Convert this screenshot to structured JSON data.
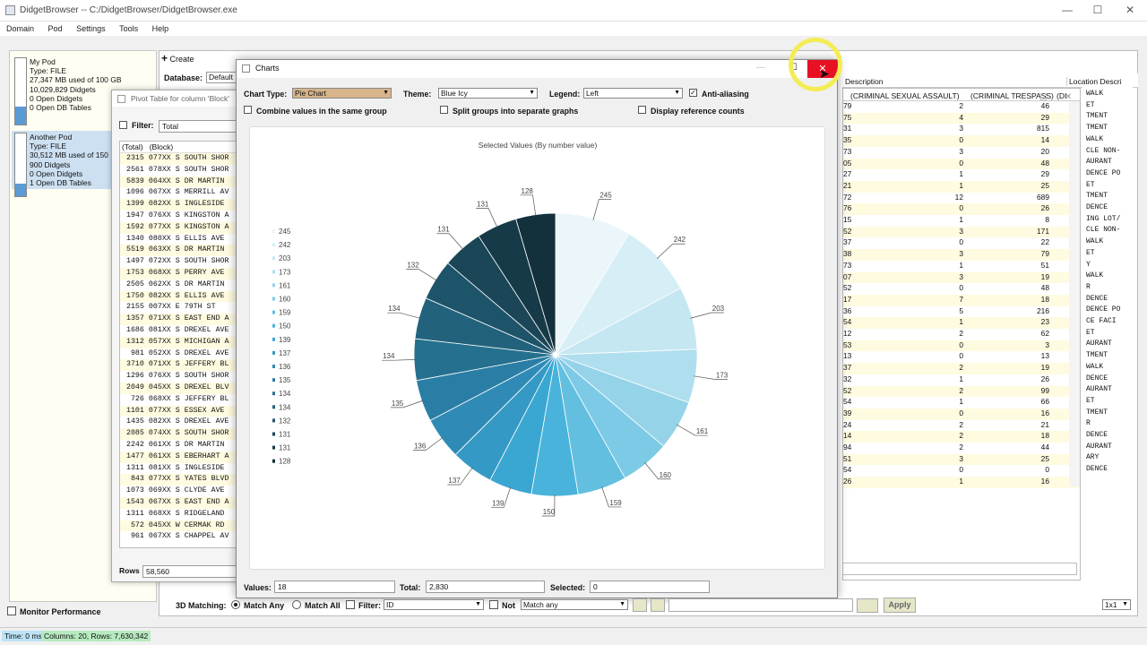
{
  "app": {
    "title": "DidgetBrowser  --  C:/DidgetBrowser/DidgetBrowser.exe"
  },
  "menu": [
    "Domain",
    "Pod",
    "Settings",
    "Tools",
    "Help"
  ],
  "pods": [
    {
      "name": "My Pod",
      "type": "Type: FILE",
      "usage": "27,347 MB used of 100 GB",
      "didgets": "10,029,829 Didgets",
      "open_didgets": "0 Open Didgets",
      "open_tables": "0 Open DB Tables",
      "fill": 0.27
    },
    {
      "name": "Another Pod",
      "type": "Type: FILE",
      "usage": "30,512 MB used of 150",
      "didgets": "900 Didgets",
      "open_didgets": "0 Open Didgets",
      "open_tables": "1 Open DB Tables",
      "fill": 0.2
    }
  ],
  "monitor_performance": "Monitor Performance",
  "toolbar": {
    "create": "Create",
    "database_label": "Database:",
    "database_value": "Default"
  },
  "grid": {
    "headers": [
      "(CRIMINAL SEXUAL ASSAULT)",
      "(CRIMINAL TRESPASS)",
      "(DI",
      "Description",
      "Location Descri"
    ],
    "rows": [
      [
        "2",
        "46",
        "WALK"
      ],
      [
        "4",
        "29",
        "ET"
      ],
      [
        "3",
        "815",
        "TMENT"
      ],
      [
        "0",
        "14",
        "TMENT"
      ],
      [
        "3",
        "20",
        "WALK"
      ],
      [
        "0",
        "48",
        "CLE NON-"
      ],
      [
        "1",
        "29",
        "AURANT"
      ],
      [
        "1",
        "25",
        "DENCE PO"
      ],
      [
        "12",
        "689",
        "ET"
      ],
      [
        "0",
        "26",
        "TMENT"
      ],
      [
        "1",
        "8",
        "DENCE"
      ],
      [
        "3",
        "171",
        "ING LOT/"
      ],
      [
        "0",
        "22",
        "CLE NON-"
      ],
      [
        "3",
        "79",
        "WALK"
      ],
      [
        "1",
        "51",
        "ET"
      ],
      [
        "3",
        "19",
        "Y"
      ],
      [
        "0",
        "48",
        "WALK"
      ],
      [
        "7",
        "18",
        "R"
      ],
      [
        "5",
        "216",
        "DENCE"
      ],
      [
        "1",
        "23",
        "DENCE PO"
      ],
      [
        "2",
        "62",
        "CE FACI"
      ],
      [
        "0",
        "3",
        "ET"
      ],
      [
        "0",
        "13",
        "AURANT"
      ],
      [
        "2",
        "19",
        "TMENT"
      ],
      [
        "1",
        "26",
        "WALK"
      ],
      [
        "2",
        "99",
        "DENCE"
      ],
      [
        "1",
        "66",
        "AURANT"
      ],
      [
        "0",
        "16",
        "ET"
      ],
      [
        "2",
        "21",
        "TMENT"
      ],
      [
        "2",
        "18",
        "R"
      ],
      [
        "2",
        "44",
        "DENCE"
      ],
      [
        "3",
        "25",
        "AURANT"
      ],
      [
        "0",
        "0",
        "ARY"
      ],
      [
        "1",
        "16",
        "DENCE"
      ]
    ],
    "left_codes": [
      "79",
      "75",
      "31",
      "35",
      "73",
      "05",
      "27",
      "21",
      "72",
      "76",
      "15",
      "52",
      "37",
      "38",
      "73",
      "07",
      "52",
      "17",
      "36",
      "54",
      "12",
      "53",
      "13",
      "37",
      "32",
      "52",
      "54",
      "39",
      "24",
      "14",
      "94",
      "51",
      "54",
      "26"
    ]
  },
  "pivot": {
    "title": "Pivot Table for column 'Block'",
    "filter_label": "Filter:",
    "filter_value": "Total",
    "col_total": "(Total)",
    "col_block": "(Block)",
    "rows": [
      [
        "2315",
        "077XX S SOUTH SHOR"
      ],
      [
        "2561",
        "078XX S SOUTH SHOR"
      ],
      [
        "5839",
        "064XX S DR MARTIN"
      ],
      [
        "1096",
        "067XX S MERRILL AV"
      ],
      [
        "1399",
        "082XX S INGLESIDE"
      ],
      [
        "1947",
        "076XX S KINGSTON A"
      ],
      [
        "1592",
        "077XX S KINGSTON A"
      ],
      [
        "1340",
        "080XX S ELLIS AVE"
      ],
      [
        "5519",
        "063XX S DR MARTIN"
      ],
      [
        "1497",
        "072XX S SOUTH SHOR"
      ],
      [
        "1753",
        "068XX S PERRY AVE"
      ],
      [
        "2505",
        "062XX S DR MARTIN"
      ],
      [
        "1750",
        "082XX S ELLIS AVE"
      ],
      [
        "2155",
        "007XX E 79TH ST"
      ],
      [
        "1357",
        "071XX S EAST END A"
      ],
      [
        "1686",
        "081XX S DREXEL AVE"
      ],
      [
        "1312",
        "057XX S MICHIGAN A"
      ],
      [
        "981",
        "052XX S DREXEL AVE"
      ],
      [
        "3710",
        "071XX S JEFFERY BL"
      ],
      [
        "1296",
        "076XX S SOUTH SHOR"
      ],
      [
        "2049",
        "045XX S DREXEL BLV"
      ],
      [
        "726",
        "068XX S JEFFERY BL"
      ],
      [
        "1101",
        "077XX S ESSEX AVE"
      ],
      [
        "1435",
        "082XX S DREXEL AVE"
      ],
      [
        "2085",
        "074XX S SOUTH SHOR"
      ],
      [
        "2242",
        "061XX S DR MARTIN"
      ],
      [
        "1477",
        "061XX S EBERHART A"
      ],
      [
        "1311",
        "081XX S INGLESIDE"
      ],
      [
        "843",
        "077XX S YATES BLVD"
      ],
      [
        "1073",
        "069XX S CLYDE AVE"
      ],
      [
        "1543",
        "067XX S EAST END A"
      ],
      [
        "1311",
        "068XX S RIDGELAND"
      ],
      [
        "572",
        "045XX W CERMAK RD"
      ],
      [
        "961",
        "067XX S CHAPPEL AV"
      ]
    ],
    "rows_label": "Rows",
    "rows_value": "58,560"
  },
  "charts": {
    "title": "Charts",
    "chart_type_label": "Chart Type:",
    "chart_type_value": "Pie Chart",
    "theme_label": "Theme:",
    "theme_value": "Blue Icy",
    "legend_label": "Legend:",
    "legend_value": "Left",
    "antialias_label": "Anti-aliasing",
    "combine_label": "Combine values in the same group",
    "split_label": "Split groups into separate graphs",
    "refcounts_label": "Display reference counts",
    "values_label": "Values:",
    "values_value": "18",
    "total_label": "Total:",
    "total_value": "2,830",
    "selected_label": "Selected:",
    "selected_value": "0"
  },
  "chart_data": {
    "type": "pie",
    "title": "Selected Values (By number value)",
    "values": [
      245,
      242,
      203,
      173,
      161,
      160,
      159,
      150,
      139,
      137,
      136,
      135,
      134,
      134,
      132,
      131,
      131,
      128
    ],
    "labels": [
      "245",
      "242",
      "203",
      "173",
      "161",
      "160",
      "159",
      "150",
      "139",
      "137",
      "136",
      "135",
      "134",
      "134",
      "132",
      "131",
      "131",
      "128"
    ],
    "legend_placement": "left",
    "colors": [
      "#eaf6fa",
      "#d6eef6",
      "#c5e7f2",
      "#afdeee",
      "#95d3e9",
      "#7ccae5",
      "#62bfe0",
      "#49b3db",
      "#3aa7d2",
      "#3499c4",
      "#2f8bb5",
      "#2a7ea5",
      "#26708f",
      "#22627c",
      "#1e5469",
      "#1a4658",
      "#173a49",
      "#13303d"
    ]
  },
  "bottom": {
    "matching_label": "3D Matching:",
    "match_any": "Match Any",
    "match_all": "Match All",
    "filter_label": "Filter:",
    "filter_value": "ID",
    "not_label": "Not",
    "match_value": "Match any",
    "apply": "Apply",
    "zoom": "1x1"
  },
  "status": {
    "time": "Time: 0 ms",
    "columns": "Columns: 20,  Rows: 7,630,342"
  }
}
